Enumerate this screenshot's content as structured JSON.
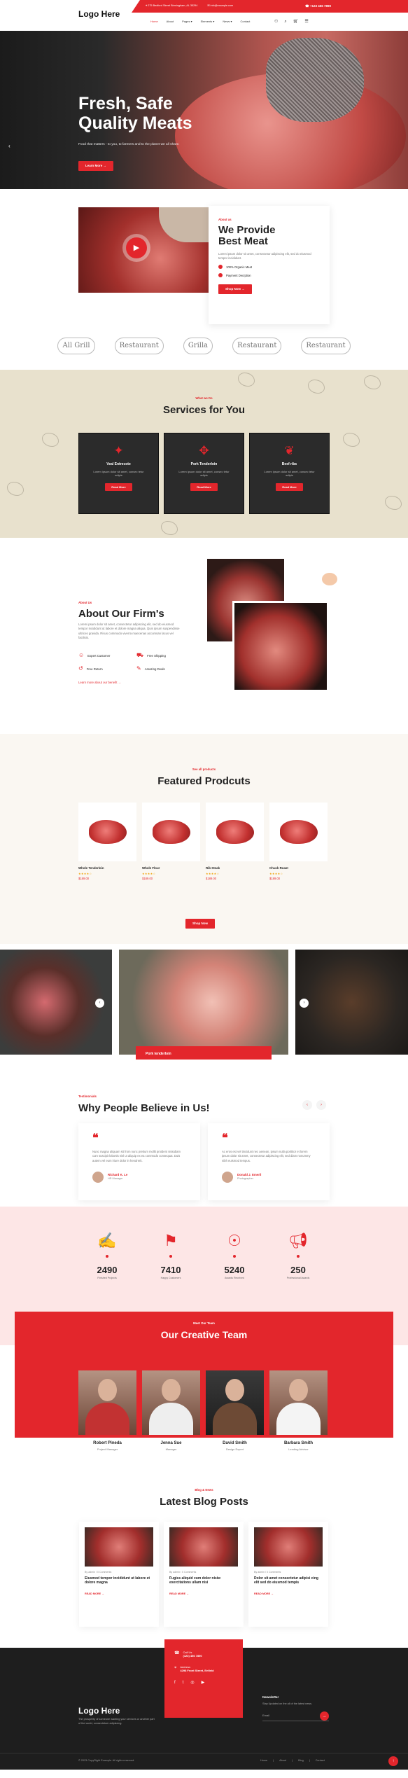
{
  "header": {
    "logo": "Logo Here",
    "address": "275 Bedford Street Birmingham, AL 35294",
    "email": "info@example.com",
    "phone": "+123 456 7890",
    "nav": [
      "Home",
      "About",
      "Pages",
      "Elements",
      "News",
      "Contact"
    ]
  },
  "hero": {
    "title_line1": "Fresh, Safe",
    "title_line2": "Quality Meats",
    "subtitle": "Food that matters - to you, to farmers and to the planet we all share.",
    "button": "Learn More"
  },
  "provide": {
    "kicker": "About us",
    "title_line1": "We Provide",
    "title_line2": "Best Meat",
    "text": "Lorem ipsum dolor sit amet, consectetur adipiscing elit, sed do eiusmod tempor incididunt.",
    "checks": [
      "100% Organic Meat",
      "Payment Decrption"
    ],
    "button": "Shop Now"
  },
  "logos": [
    "All Grill",
    "Restaurant",
    "Grilla",
    "Restaurant",
    "Restaurant"
  ],
  "services": {
    "kicker": "What we Do",
    "title": "Services for You",
    "items": [
      {
        "title": "Veal Entrecote",
        "text": "Lorem ipsum dolor sit amet, consec tetur adipis",
        "button": "Read More"
      },
      {
        "title": "Pork Tenderloin",
        "text": "Lorem ipsum dolor sit amet, consec tetur adipis",
        "button": "Read More"
      },
      {
        "title": "Beef ribs",
        "text": "Lorem ipsum dolor sit amet, consec tetur adipis",
        "button": "Read More"
      }
    ]
  },
  "about": {
    "kicker": "About Us",
    "title": "About Our Firm's",
    "text": "Lorem ipsum dolor sit amet, consectetur adipiscing elit, sed do eiusmod tempor incididunt ut labore et dolore magna aliqua. Quis ipsum suspendisse ultrices gravida. Risus commodo viverra maecenas accumsan lacus vel facilisis.",
    "features": [
      "Expert Customer",
      "Free Shipping",
      "Free Return",
      "Amazing Deals"
    ],
    "link": "Learn more about our benefit"
  },
  "products": {
    "kicker": "See all products",
    "title": "Featured Prodcuts",
    "items": [
      {
        "name": "Whole Tenderloin",
        "price": "$189.00"
      },
      {
        "name": "Whole Flour",
        "price": "$189.00"
      },
      {
        "name": "Rib Steak",
        "price": "$189.00"
      },
      {
        "name": "Chuck Roast",
        "price": "$189.00"
      }
    ],
    "stars": "★★★★☆",
    "button": "Shop Now"
  },
  "gallery": {
    "caption": "Pork tenderloin"
  },
  "testimonials": {
    "kicker": "Testimonials",
    "title": "Why People Believe in Us!",
    "items": [
      {
        "text": "Nunc magna aliquam sit from nunc pretium mollit proident nisiodiam cum suscipit lobortis nisl ut aliquip ex ea commodo consequat. Duis autem vel eum iriure dolor in hendrerit.",
        "name": "Richard K. Le",
        "role": "HR Manager"
      },
      {
        "text": "Ac eros est vel tincidunt nec aenean, ipsum nulla porttitor et lorem ipsum dolor sit amet, consectetur adipiscing elit, sed diam nonummy nibh euismod tempus.",
        "name": "Donald J. Emeril",
        "role": "Photographer"
      }
    ]
  },
  "stats": [
    {
      "value": "2490",
      "label": "Finished Projects"
    },
    {
      "value": "7410",
      "label": "Happy Customers"
    },
    {
      "value": "5240",
      "label": "Awards Received"
    },
    {
      "value": "250",
      "label": "Professional Awards"
    }
  ],
  "team": {
    "kicker": "Meet Our Team",
    "title": "Our Creative Team",
    "members": [
      {
        "name": "Robert Pineda",
        "role": "Project Manager"
      },
      {
        "name": "Jenna Sue",
        "role": "Manager"
      },
      {
        "name": "David Smith",
        "role": "Design Expert"
      },
      {
        "name": "Barbara Smith",
        "role": "Lending Advisor"
      }
    ]
  },
  "blog": {
    "kicker": "Blog & News",
    "title": "Latest Blog Posts",
    "posts": [
      {
        "meta": "By admin / 0 Comments",
        "title": "Eiusmod tempor incididunt ut labore et dolore magna",
        "link": "READ MORE"
      },
      {
        "meta": "By admin / 0 Comments",
        "title": "Fugiss aliquid cum dolor nisiw exercitations ullam nisi",
        "link": "READ MORE"
      },
      {
        "meta": "By admin / 0 Comments",
        "title": "Dolor sit amet consectetur adipisi cing elit sed do eiusmod tempis",
        "link": "READ MORE"
      }
    ]
  },
  "footer": {
    "logo": "Logo Here",
    "description": "The prosperity of someone wanting your services or another part of the world, consectetuer adipiscing.",
    "call_label": "Call Us",
    "phone": "(123) 456 7890",
    "address_label": "Address",
    "address": "4298 Front Street, Enfield",
    "newsletter_title": "Newsletter",
    "newsletter_text": "Stay Updated on the all of the latest news.",
    "email_placeholder": "Email",
    "copyright": "© 2023 CopyRight Example. All rights reserved.",
    "links": [
      "Home",
      "About",
      "Blog",
      "Contact"
    ]
  }
}
